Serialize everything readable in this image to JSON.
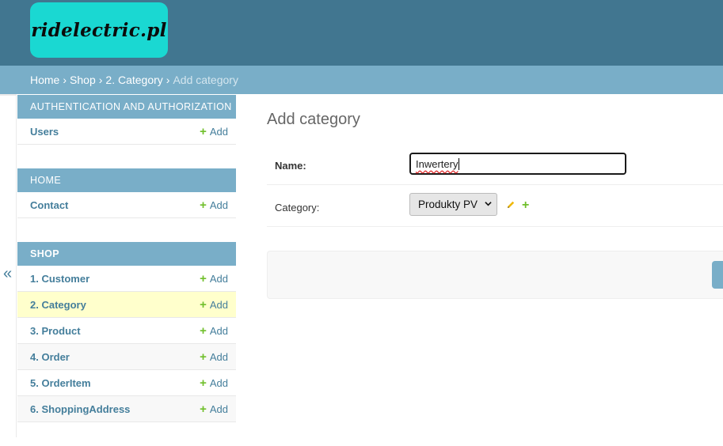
{
  "logo": {
    "text": "ridelectric.pl"
  },
  "breadcrumbs": {
    "home": "Home",
    "shop": "Shop",
    "category": "2. Category",
    "current": "Add category",
    "separator": "›"
  },
  "sidebar_toggle": "«",
  "sidebar": {
    "auth": {
      "caption": "AUTHENTICATION AND AUTHORIZATION",
      "items": [
        {
          "label": "Users",
          "add": "Add"
        }
      ]
    },
    "home": {
      "caption": "HOME",
      "items": [
        {
          "label": "Contact",
          "add": "Add"
        }
      ]
    },
    "shop": {
      "caption": "SHOP",
      "items": [
        {
          "label": "1. Customer",
          "add": "Add"
        },
        {
          "label": "2. Category",
          "add": "Add"
        },
        {
          "label": "3. Product",
          "add": "Add"
        },
        {
          "label": "4. Order",
          "add": "Add"
        },
        {
          "label": "5. OrderItem",
          "add": "Add"
        },
        {
          "label": "6. ShoppingAddress",
          "add": "Add"
        }
      ]
    }
  },
  "main": {
    "title": "Add category",
    "name_field": {
      "label": "Name:",
      "value": "Inwertery"
    },
    "category_field": {
      "label": "Category:",
      "selected": "Produkty PV"
    }
  },
  "colors": {
    "header": "#417690",
    "breadcrumbs": "#79aec8",
    "logo_bg": "#1ad8d2",
    "link": "#447e9b",
    "add_plus": "#70bf2b",
    "active_row": "#ffffcc"
  },
  "icons": {
    "add": "plus-icon",
    "edit": "pencil-icon",
    "collapse": "double-chevron-left-icon"
  }
}
